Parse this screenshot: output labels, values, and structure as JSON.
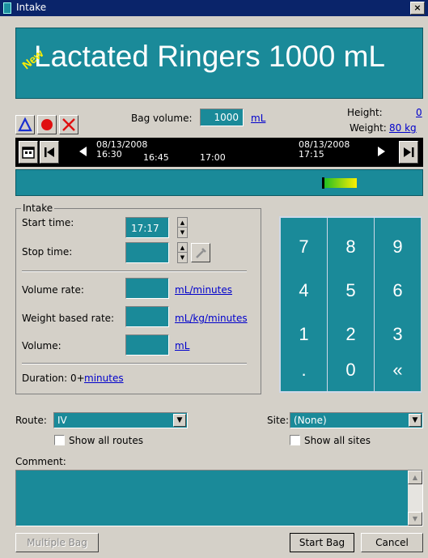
{
  "window": {
    "title": "Intake",
    "close_glyph": "×"
  },
  "banner": {
    "drug_name": "Lactated Ringers 1000 mL",
    "new_badge": "New"
  },
  "bag": {
    "label": "Bag volume:",
    "value": "1000",
    "unit": "mL"
  },
  "patient": {
    "height_label": "Height:",
    "height_value": "0",
    "weight_label": "Weight:",
    "weight_value": "80 kg"
  },
  "toolbar": {
    "delta_icon": "delta-icon",
    "record_icon": "record-icon",
    "delete_icon": "x-icon"
  },
  "timeline": {
    "start_date": "08/13/2008",
    "start_time": "16:30",
    "t2": "16:45",
    "t3": "17:00",
    "end_date": "08/13/2008",
    "end_time": "17:15"
  },
  "colors": {
    "teal": "#1a8a99",
    "progress_marker_start": "#22c022",
    "progress_marker_end": "#ffef00"
  },
  "intake": {
    "group_label": "Intake",
    "start_time_label": "Start time:",
    "start_time_value": "17:17",
    "stop_time_label": "Stop time:",
    "stop_time_value": "",
    "volume_rate_label": "Volume rate:",
    "volume_rate_value": "",
    "volume_rate_unit": "mL/minutes",
    "weight_rate_label": "Weight based rate:",
    "weight_rate_value": "",
    "weight_rate_unit": "mL/kg/minutes",
    "volume_label": "Volume:",
    "volume_value": "",
    "volume_unit": "mL",
    "duration_label": "Duration: 0+",
    "duration_unit": "minutes"
  },
  "keypad": {
    "keys": [
      "7",
      "8",
      "9",
      "4",
      "5",
      "6",
      "1",
      "2",
      "3",
      ".",
      "0",
      "«"
    ]
  },
  "route": {
    "label": "Route:",
    "value": "IV",
    "show_all": "Show all routes"
  },
  "site": {
    "label": "Site:",
    "value": "(None)",
    "show_all": "Show all sites"
  },
  "comment": {
    "label": "Comment:",
    "value": ""
  },
  "buttons": {
    "multiple_bag": "Multiple Bag",
    "start_bag": "Start Bag",
    "cancel": "Cancel"
  }
}
